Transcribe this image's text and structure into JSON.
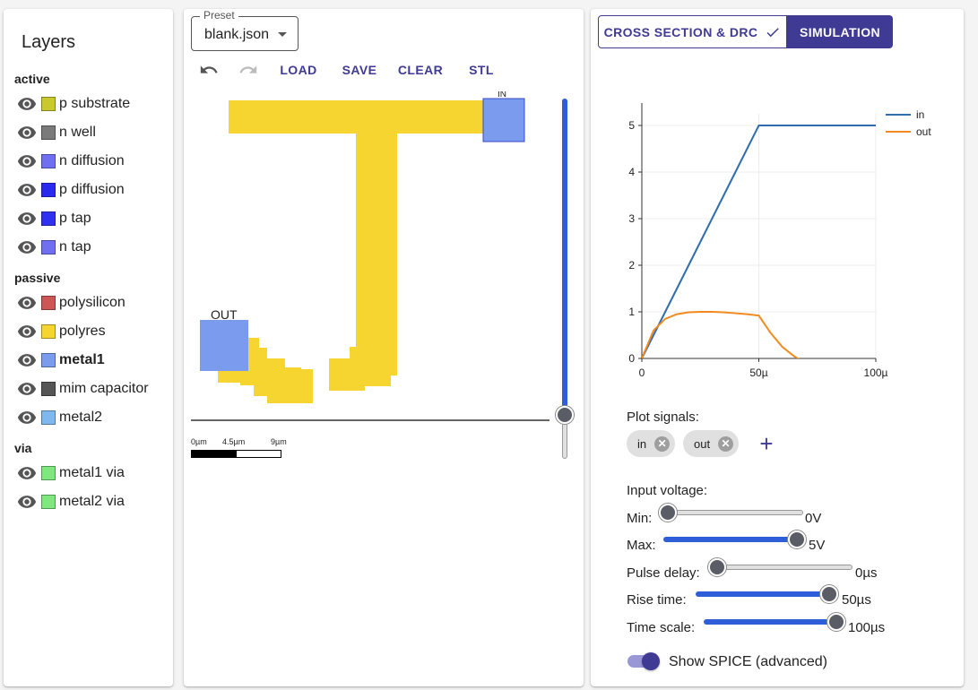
{
  "layers": {
    "title": "Layers",
    "groups": [
      {
        "name": "active",
        "items": [
          {
            "label": "p substrate",
            "color": "#c9c92e",
            "bold": false
          },
          {
            "label": "n well",
            "color": "#7a7a7a",
            "bold": false
          },
          {
            "label": "n diffusion",
            "color": "#6f6ff0",
            "bold": false
          },
          {
            "label": "p diffusion",
            "color": "#2a2aee",
            "bold": false
          },
          {
            "label": "p tap",
            "color": "#3030f0",
            "bold": false
          },
          {
            "label": "n tap",
            "color": "#6f6ff0",
            "bold": false
          }
        ]
      },
      {
        "name": "passive",
        "items": [
          {
            "label": "polysilicon",
            "color": "#cc5555",
            "bold": false
          },
          {
            "label": "polyres",
            "color": "#f7d531",
            "bold": false
          },
          {
            "label": "metal1",
            "color": "#7b9bef",
            "bold": true
          },
          {
            "label": "mim capacitor",
            "color": "#555555",
            "bold": false
          },
          {
            "label": "metal2",
            "color": "#7fb8ef",
            "bold": false
          }
        ]
      },
      {
        "name": "via",
        "items": [
          {
            "label": "metal1 via",
            "color": "#7ee87e",
            "bold": false
          },
          {
            "label": "metal2 via",
            "color": "#7ee87e",
            "bold": false
          }
        ]
      }
    ]
  },
  "editor": {
    "preset_legend": "Preset",
    "preset_value": "blank.json",
    "toolbar": {
      "load": "LOAD",
      "save": "SAVE",
      "clear": "CLEAR",
      "stl": "STL"
    },
    "canvas": {
      "out_label": "OUT",
      "in_label": "IN"
    },
    "scale": {
      "labels": [
        "0µm",
        "4.5µm",
        "9µm"
      ]
    }
  },
  "simulation": {
    "tabs": {
      "cross_section": "CROSS SECTION & DRC",
      "simulation": "SIMULATION"
    },
    "plot_signals_label": "Plot signals:",
    "signals": [
      "in",
      "out"
    ],
    "input_title": "Input voltage:",
    "sliders": [
      {
        "label": "Min:",
        "value": "0V",
        "level": 0.0
      },
      {
        "label": "Max:",
        "value": "5V",
        "level": 1.0
      },
      {
        "label": "Pulse delay:",
        "value": "0µs",
        "level": 0.0
      },
      {
        "label": "Rise time:",
        "value": "50µs",
        "level": 1.0
      },
      {
        "label": "Time scale:",
        "value": "100µs",
        "level": 1.0
      }
    ],
    "show_spice": "Show SPICE (advanced)",
    "show_spice_on": true
  },
  "chart_data": {
    "type": "line",
    "x": [
      0,
      5,
      10,
      15,
      20,
      25,
      30,
      35,
      40,
      45,
      50,
      55,
      60,
      65,
      70,
      75,
      80
    ],
    "series": [
      {
        "name": "in",
        "color": "#2f6db0",
        "values": [
          0,
          0.5,
          1.0,
          1.5,
          2.0,
          2.5,
          3.0,
          3.5,
          4.0,
          4.5,
          5,
          5,
          5,
          5,
          5,
          5,
          5
        ]
      },
      {
        "name": "out",
        "color": "#f28a1f",
        "values": [
          0,
          0.6,
          0.85,
          0.95,
          0.99,
          1.0,
          1.0,
          0.99,
          0.97,
          0.95,
          0.92,
          0.55,
          0.25,
          0.05,
          -0.1,
          -0.2,
          -0.25
        ]
      }
    ],
    "xtick_labels": [
      "0",
      "50µ",
      "100µ"
    ],
    "xticks": [
      0,
      50,
      100
    ],
    "yticks": [
      0,
      1,
      2,
      3,
      4,
      5
    ],
    "xlim": [
      0,
      100
    ],
    "ylim": [
      0,
      5.25
    ],
    "grid": true,
    "legend": "top-right",
    "title": "",
    "xlabel": "",
    "ylabel": ""
  }
}
